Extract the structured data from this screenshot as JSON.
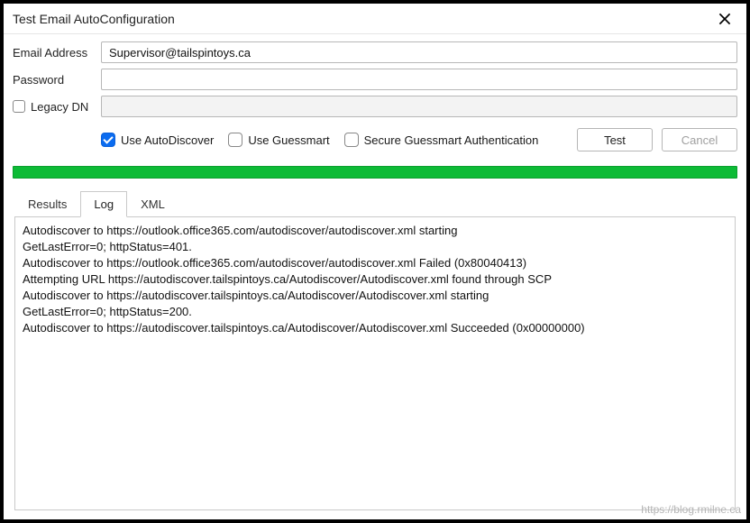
{
  "window": {
    "title": "Test Email AutoConfiguration"
  },
  "fields": {
    "email_label": "Email Address",
    "email_value": "Supervisor@tailspintoys.ca",
    "password_label": "Password",
    "password_value": "",
    "legacydn_label": "Legacy DN",
    "legacydn_value": "",
    "legacydn_checked": false
  },
  "options": {
    "autodiscover_label": "Use AutoDiscover",
    "autodiscover_checked": true,
    "guessmart_label": "Use Guessmart",
    "guessmart_checked": false,
    "secure_guessmart_label": "Secure Guessmart Authentication",
    "secure_guessmart_checked": false
  },
  "buttons": {
    "test": "Test",
    "cancel": "Cancel"
  },
  "tabs": {
    "results": "Results",
    "log": "Log",
    "xml": "XML",
    "active": "log"
  },
  "log": {
    "lines": [
      "Autodiscover to https://outlook.office365.com/autodiscover/autodiscover.xml starting",
      "GetLastError=0; httpStatus=401.",
      "Autodiscover to https://outlook.office365.com/autodiscover/autodiscover.xml Failed (0x80040413)",
      "Attempting URL https://autodiscover.tailspintoys.ca/Autodiscover/Autodiscover.xml found through SCP",
      "Autodiscover to https://autodiscover.tailspintoys.ca/Autodiscover/Autodiscover.xml starting",
      "GetLastError=0; httpStatus=200.",
      "Autodiscover to https://autodiscover.tailspintoys.ca/Autodiscover/Autodiscover.xml Succeeded (0x00000000)"
    ]
  },
  "watermark": "https://blog.rmilne.ca"
}
